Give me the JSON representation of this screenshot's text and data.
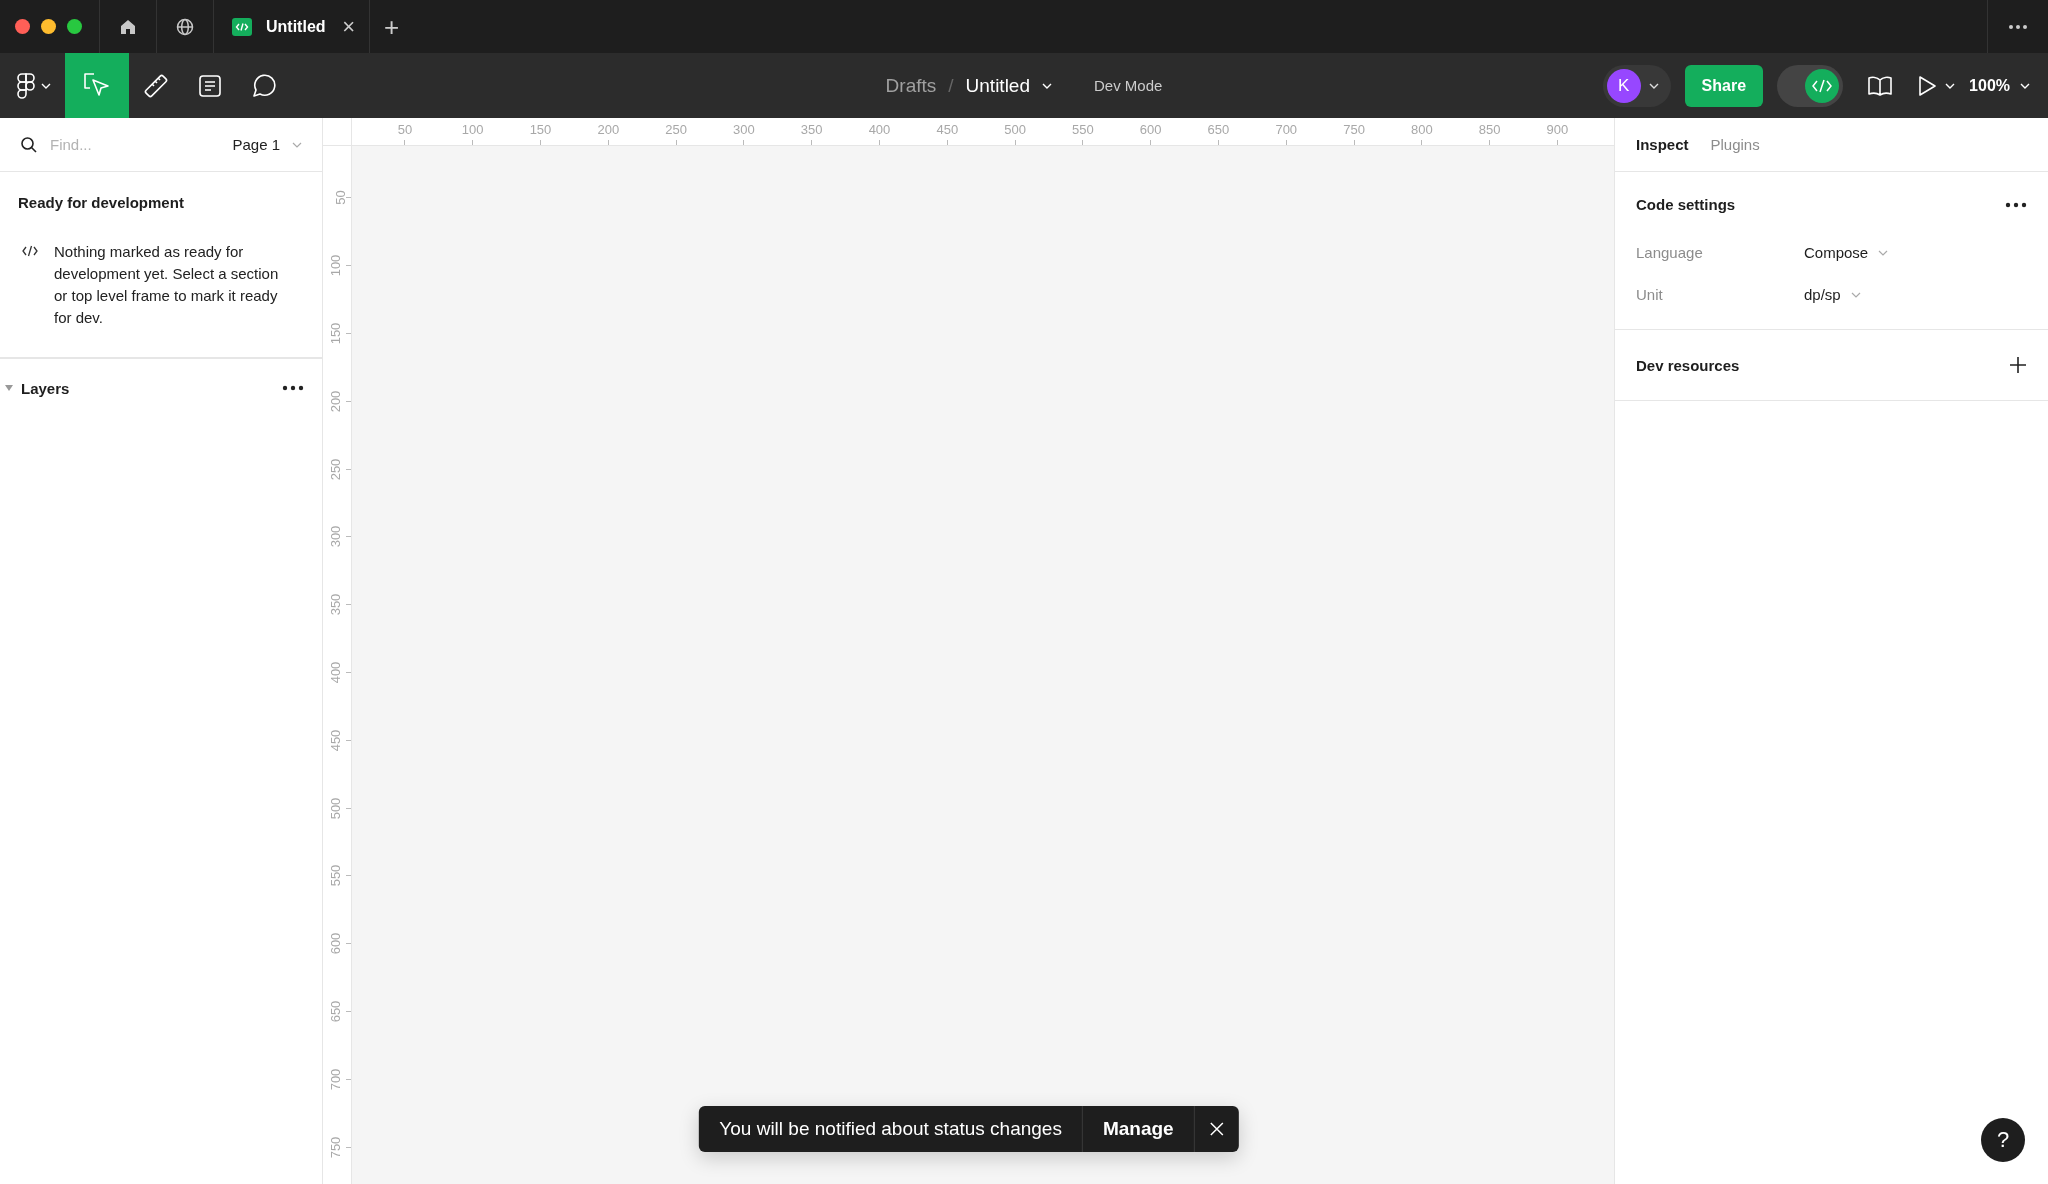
{
  "browser_tabs": [
    {
      "kind": "home"
    },
    {
      "kind": "community"
    },
    {
      "kind": "file",
      "label": "Untitled",
      "close": "×"
    }
  ],
  "new_tab": "+",
  "toolbar": {
    "tools": [
      {
        "kind": "move",
        "selected": true
      },
      {
        "kind": "measure",
        "selected": false
      },
      {
        "kind": "annotate",
        "selected": false
      },
      {
        "kind": "comment",
        "selected": false
      }
    ],
    "breadcrumb": {
      "parent": "Drafts",
      "separator": "/",
      "file": "Untitled"
    },
    "mode_label": "Dev Mode",
    "avatar": {
      "initial": "K"
    },
    "share_button": "Share",
    "dev_mode_toggle": {
      "on": true
    },
    "zoom": "100%"
  },
  "left_panel": {
    "search": {
      "placeholder": "Find..."
    },
    "page": "Page 1",
    "ready_section": {
      "title": "Ready for development",
      "message": "Nothing marked as ready for development yet. Select a section or top level frame to mark it ready for dev."
    },
    "layers": {
      "title": "Layers",
      "expanded": true
    }
  },
  "rulers": {
    "horizontal": [
      "50",
      "100",
      "150",
      "200",
      "250",
      "300",
      "350",
      "400",
      "450",
      "500",
      "550",
      "600",
      "650",
      "700",
      "750",
      "800",
      "850",
      "900"
    ],
    "vertical": [
      "50",
      "100",
      "150",
      "200",
      "250",
      "300",
      "350",
      "400",
      "450",
      "500",
      "550",
      "600",
      "650",
      "700",
      "750"
    ]
  },
  "right_panel": {
    "tabs": [
      {
        "label": "Inspect",
        "selected": true
      },
      {
        "label": "Plugins",
        "selected": false
      }
    ],
    "code_settings": {
      "title": "Code settings",
      "settings": [
        {
          "label": "Language",
          "value": "Compose"
        },
        {
          "label": "Unit",
          "value": "dp/sp"
        }
      ]
    },
    "dev_resources": {
      "title": "Dev resources"
    }
  },
  "toast": {
    "message": "You will be notified about status changes",
    "action": "Manage"
  },
  "help_button": "?"
}
